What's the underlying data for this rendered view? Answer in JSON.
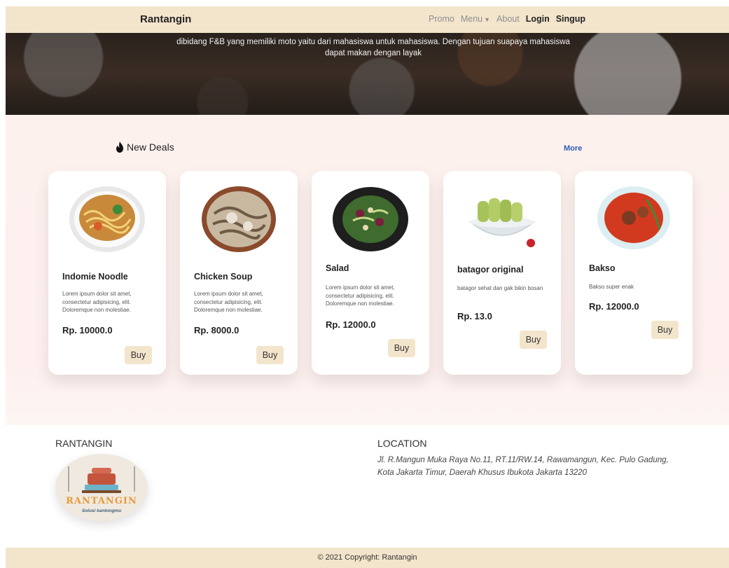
{
  "navbar": {
    "brand": "Rantangin",
    "links": {
      "promo": "Promo",
      "menu": "Menu",
      "about": "About",
      "login": "Login",
      "signup": "Singup"
    }
  },
  "hero": {
    "line1": "dibidang F&B yang memiliki moto yaitu dari mahasiswa untuk mahasiswa. Dengan tujuan suapaya mahasiswa",
    "line2": "dapat makan dengan layak"
  },
  "deals": {
    "title": "New Deals",
    "more": "More",
    "buy_label": "Buy",
    "items": [
      {
        "name": "Indomie Noodle",
        "description": "Lorem ipsum dolor sit amet, consectetur adipisicing, elit. Doloremque non molestiae.",
        "price": "Rp. 10000.0"
      },
      {
        "name": "Chicken Soup",
        "description": "Lorem ipsum dolor sit amet, consectetur adipisicing, elit. Doloremque non molestiae.",
        "price": "Rp. 8000.0"
      },
      {
        "name": "Salad",
        "description": "Lorem ipsum dolor sit amet, consectetur adipisicing, elit. Doloremque non molestiae.",
        "price": "Rp. 12000.0"
      },
      {
        "name": "batagor original",
        "description": "batagor sehat dan gak bikin bosan",
        "price": "Rp. 13.0"
      },
      {
        "name": "Bakso",
        "description": "Bakso super enak",
        "price": "Rp. 12000.0"
      }
    ]
  },
  "footer": {
    "brand_title": "RANTANGIN",
    "logo_text": "RANTANGIN",
    "logo_tagline": "Solusi kantongmu",
    "location_title": "LOCATION",
    "address": "Jl. R.Mangun Muka Raya No.11, RT.11/RW.14, Rawamangun, Kec. Pulo Gadung, Kota Jakarta Timur, Daerah Khusus Ibukota Jakarta 13220",
    "copyright": "© 2021 Copyright: Rantangin"
  },
  "colors": {
    "navbar_bg": "#f3e5cc",
    "deals_bg": "#fdf1ee",
    "link_blue": "#2a5db0",
    "button_bg": "#f3e5cc"
  }
}
